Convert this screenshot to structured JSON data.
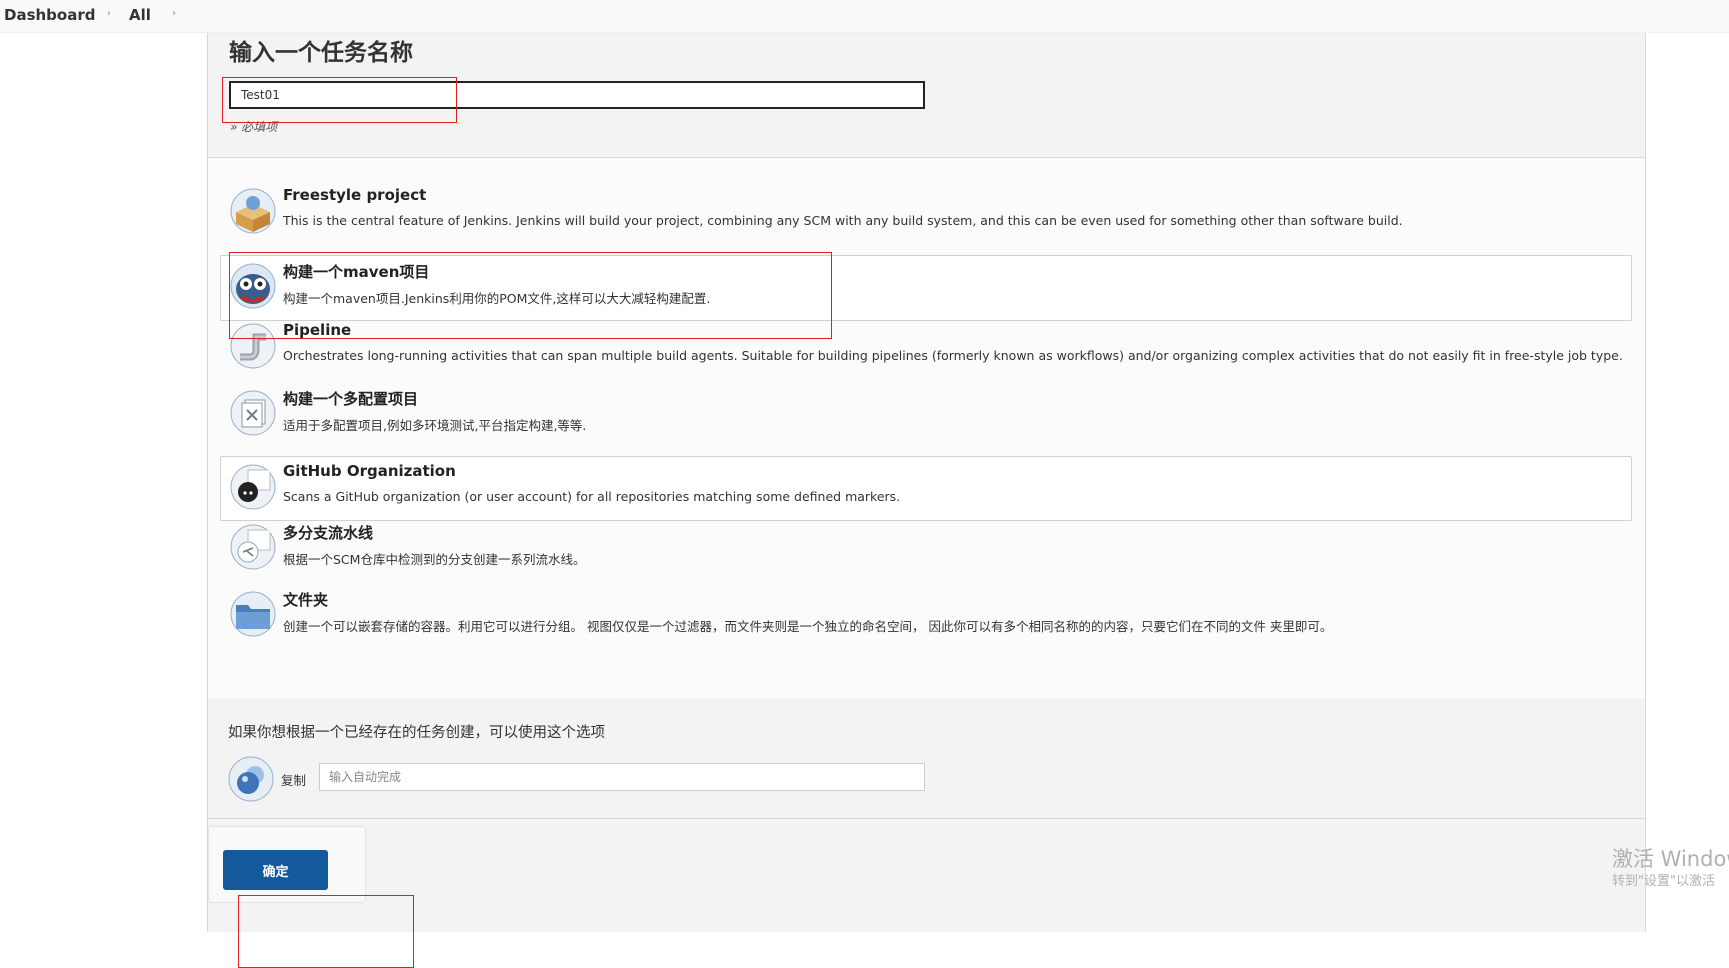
{
  "breadcrumb": {
    "items": [
      "Dashboard",
      "All"
    ],
    "separator": "›"
  },
  "form": {
    "title": "输入一个任务名称",
    "name_value": "Test01",
    "required_hint": "» 必填项"
  },
  "job_types": [
    {
      "icon": "freestyle-box-icon",
      "title": "Freestyle project",
      "desc": "This is the central feature of Jenkins. Jenkins will build your project, combining any SCM with any build system, and this can be even used for something other than software build."
    },
    {
      "icon": "maven-owl-icon",
      "title": "构建一个maven项目",
      "desc": "构建一个maven项目.Jenkins利用你的POM文件,这样可以大大减轻构建配置."
    },
    {
      "icon": "pipeline-pipe-icon",
      "title": "Pipeline",
      "desc": "Orchestrates long-running activities that can span multiple build agents. Suitable for building pipelines (formerly known as workflows) and/or organizing complex activities that do not easily fit in free-style job type."
    },
    {
      "icon": "multi-config-icon",
      "title": "构建一个多配置项目",
      "desc": "适用于多配置项目,例如多环境测试,平台指定构建,等等."
    },
    {
      "icon": "github-octocat-icon",
      "title": "GitHub Organization",
      "desc": "Scans a GitHub organization (or user account) for all repositories matching some defined markers."
    },
    {
      "icon": "multibranch-icon",
      "title": "多分支流水线",
      "desc": "根据一个SCM仓库中检测到的分支创建一系列流水线。"
    },
    {
      "icon": "folder-icon",
      "title": "文件夹",
      "desc": "创建一个可以嵌套存储的容器。利用它可以进行分组。 视图仅仅是一个过滤器，而文件夹则是一个独立的命名空间， 因此你可以有多个相同名称的的内容，只要它们在不同的文件 夹里即可。"
    }
  ],
  "copy": {
    "prompt": "如果你想根据一个已经存在的任务创建，可以使用这个选项",
    "label": "复制",
    "placeholder": "输入自动完成"
  },
  "ok_button": "确定",
  "watermark": {
    "line1": "激活 Window",
    "line2": "转到\"设置\"以激活 "
  },
  "colors": {
    "primary_button": "#14599b",
    "highlight": "#e02020"
  }
}
